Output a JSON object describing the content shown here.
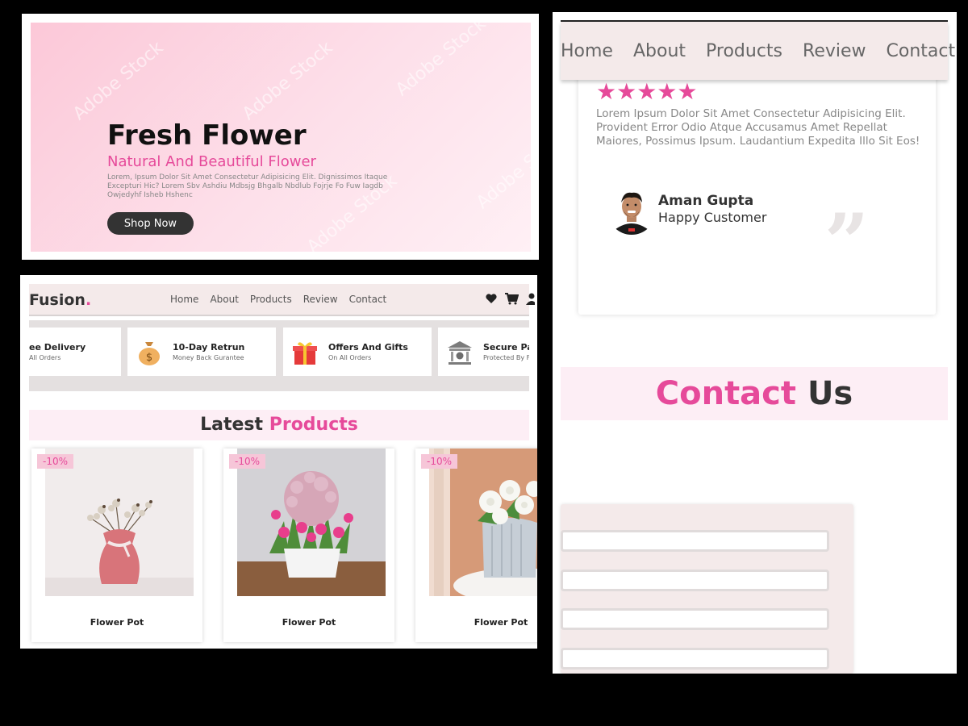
{
  "hero": {
    "title": "Fresh Flower",
    "subtitle": "Natural And Beautiful Flower",
    "description": "Lorem, Ipsum Dolor Sit Amet Consectetur Adipisicing Elit. Dignissimos Itaque Excepturi Hic? Lorem Sbv Ashdiu Mdbsjg Bhgalb Nbdlub Fojrje Fo Fuw Iagdb Owjedyhf Isheb Hshenc",
    "button_label": "Shop Now",
    "watermark": "Adobe Stock"
  },
  "store": {
    "logo_text": "Fusion",
    "logo_dot": ".",
    "nav": [
      "Home",
      "About",
      "Products",
      "Review",
      "Contact"
    ],
    "icons": [
      "heart-icon",
      "cart-icon",
      "user-icon"
    ],
    "features": [
      {
        "title": "ee Delivery",
        "subtitle": "All Orders",
        "icon": "delivery-icon"
      },
      {
        "title": "10-Day Retrun",
        "subtitle": "Money Back Gurantee",
        "icon": "money-bag-icon"
      },
      {
        "title": "Offers And Gifts",
        "subtitle": "On All Orders",
        "icon": "gift-icon"
      },
      {
        "title": "Secure Pa",
        "subtitle": "Protected By F",
        "icon": "bank-icon"
      }
    ],
    "latest_heading": "Latest",
    "latest_accent": "Products",
    "products": [
      {
        "discount": "-10%",
        "name": "Flower Pot"
      },
      {
        "discount": "-10%",
        "name": "Flower Pot"
      },
      {
        "discount": "-10%",
        "name": "Flower Pot"
      }
    ]
  },
  "review_page": {
    "nav": [
      "Home",
      "About",
      "Products",
      "Review",
      "Contact"
    ],
    "stars": "★★★★★",
    "rating": 5,
    "review_text": "Lorem Ipsum Dolor Sit Amet Consectetur Adipisicing Elit. Provident Error Odio Atque Accusamus Amet Repellat Maiores, Possimus Ipsum. Laudantium Expedita Illo Sit Eos!",
    "reviewer_name": "Aman Gupta",
    "reviewer_role": "Happy Customer",
    "contact_heading_accent": "Contact",
    "contact_heading": "Us"
  },
  "colors": {
    "accent": "#e64a9a",
    "nav_bg": "#f4eaea",
    "banner_bg": "#fdeef5",
    "dark_button": "#333333"
  }
}
